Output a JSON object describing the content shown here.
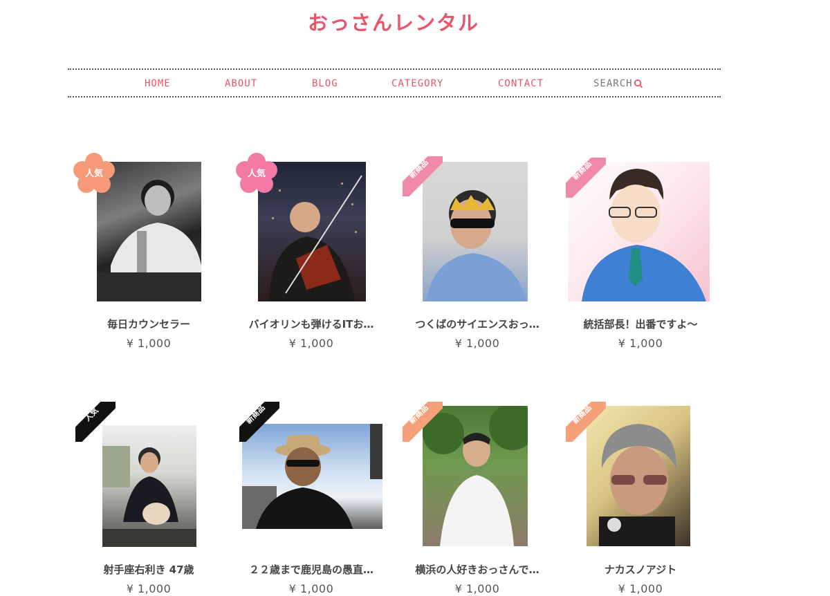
{
  "site": {
    "title": "おっさんレンタル"
  },
  "nav": {
    "items": [
      "HOME",
      "ABOUT",
      "BLOG",
      "CATEGORY",
      "CONTACT"
    ],
    "search_label": "SEARCH"
  },
  "colors": {
    "brand": "#e8546a",
    "badge_popular_flower": "#f79a7a",
    "badge_pink_flower": "#f27aa4",
    "ribbon_pink": "#f08aa6",
    "ribbon_orange": "#f6a07a",
    "ribbon_black": "#111111"
  },
  "products": [
    {
      "title": "毎日カウンセラー",
      "price": "¥ 1,000",
      "badge": "人気",
      "photo": "bw-man-bar-photo"
    },
    {
      "title": "バイオリンも弾けるITお…",
      "price": "¥ 1,000",
      "badge": "人気",
      "photo": "violinist-night-photo"
    },
    {
      "title": "つくばのサイエンスおっ…",
      "price": "¥ 1,000",
      "badge": "新商品",
      "photo": "crown-sunglasses-photo"
    },
    {
      "title": "統括部長！出番ですよ〜",
      "price": "¥ 1,000",
      "badge": "新商品",
      "photo": "illustration-manager-photo"
    },
    {
      "title": "射手座右利き 47歳",
      "price": "¥ 1,000",
      "badge": "人気",
      "photo": "man-with-dog-photo"
    },
    {
      "title": "２２歳まで鹿児島の愚直…",
      "price": "¥ 1,000",
      "badge": "新商品",
      "photo": "hat-sunglasses-sky-photo"
    },
    {
      "title": "横浜の人好きおっさんで…",
      "price": "¥ 1,000",
      "badge": "新商品",
      "photo": "white-shirt-trees-photo"
    },
    {
      "title": "ナカスノアジト",
      "price": "¥ 1,000",
      "badge": "新商品",
      "photo": "tinted-glasses-man-photo"
    }
  ]
}
